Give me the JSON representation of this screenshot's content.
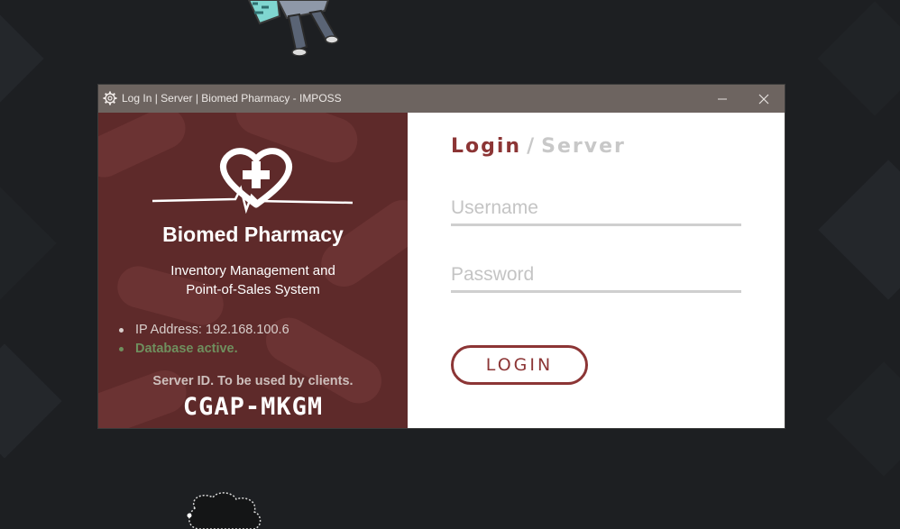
{
  "window": {
    "title": "Log In | Server | Biomed Pharmacy - IMPOSS",
    "minimize_icon": "minimize-icon",
    "close_icon": "close-icon"
  },
  "brand": {
    "name": "Biomed Pharmacy",
    "subtitle_line1": "Inventory Management and",
    "subtitle_line2": "Point-of-Sales System",
    "logo_icon": "heart-cross-heartbeat-logo"
  },
  "status": {
    "ip": "IP Address: 192.168.100.6",
    "database": "Database active.",
    "database_color": "#6f8f5e"
  },
  "server": {
    "note": "Server ID. To be used by clients.",
    "id": "CGAP-MKGM"
  },
  "form": {
    "heading_login": "Login",
    "heading_sep": "/",
    "heading_server": "Server",
    "username_placeholder": "Username",
    "password_placeholder": "Password",
    "login_label": "LOGIN"
  },
  "colors": {
    "accent": "#8c3535",
    "panel": "#5e2a2a",
    "titlebar": "#6d6460"
  }
}
